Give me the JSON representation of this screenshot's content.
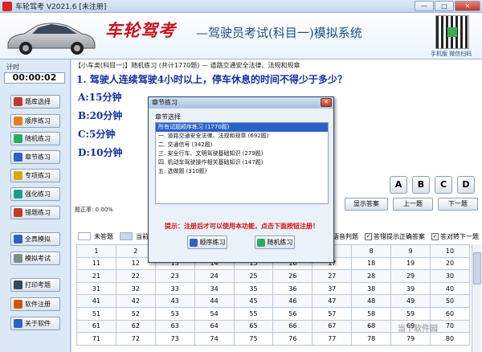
{
  "window": {
    "title": "车轮驾考 V2021.6 [未注册]",
    "minimize": "—",
    "maximize": "□",
    "close": "✕"
  },
  "banner": {
    "logo": "车轮驾考",
    "subtitle": "—驾驶员考试(科目一)模拟系统",
    "qr_label": "手机版  微信扫码"
  },
  "left": {
    "timer_label": "计时",
    "timer": "00:00:02",
    "buttons": [
      {
        "label": "题库选择",
        "color": "#c0392b"
      },
      {
        "label": "顺序练习",
        "color": "#e67e22"
      },
      {
        "label": "随机练习",
        "color": "#27ae60"
      },
      {
        "label": "章节练习",
        "color": "#2a62c8"
      },
      {
        "label": "专项练习",
        "color": "#d4ac0d"
      },
      {
        "label": "强化练习",
        "color": "#16a085"
      },
      {
        "label": "错题练习",
        "color": "#c0392b"
      },
      {
        "label": "全真模拟",
        "color": "#2a62c8"
      },
      {
        "label": "模拟考试",
        "color": "#7f8c8d"
      },
      {
        "label": "打印考题",
        "color": "#34495e"
      },
      {
        "label": "软件注册",
        "color": "#d35400"
      },
      {
        "label": "关于软件",
        "color": "#2a62c8"
      }
    ]
  },
  "main": {
    "breadcrumb": "【小车类(科目一)】随机练习 (共计1770题) — 道路交通安全法律、法规和规章",
    "question": "1. 驾驶人连续驾驶4小时以上，停车休息的时间不得少于多少？",
    "options": [
      "A:15分钟",
      "B:20分钟",
      "C:5分钟",
      "D:10分钟"
    ],
    "answer_buttons": [
      "A",
      "B",
      "C",
      "D"
    ],
    "correct_rate": "题正率: 0.00%",
    "nav": {
      "show_answer": "显示答案",
      "prev": "上一题",
      "next": "下一题"
    },
    "legend": {
      "undone": "未答题",
      "current": "当前",
      "voice": "语音判题",
      "show_correct": "答错提示正确答案",
      "auto_next": "答对转下一题"
    },
    "grid": [
      [
        "1",
        "2",
        "3",
        "4",
        "5",
        "6",
        "7",
        "8",
        "9",
        "10"
      ],
      [
        "11",
        "12",
        "13",
        "14",
        "15",
        "16",
        "17",
        "18",
        "19",
        "20"
      ],
      [
        "21",
        "22",
        "23",
        "24",
        "25",
        "26",
        "27",
        "28",
        "29",
        "30"
      ],
      [
        "31",
        "32",
        "33",
        "34",
        "35",
        "36",
        "37",
        "38",
        "39",
        "40"
      ],
      [
        "41",
        "42",
        "43",
        "44",
        "45",
        "46",
        "47",
        "48",
        "49",
        "50"
      ],
      [
        "51",
        "52",
        "53",
        "54",
        "55",
        "56",
        "57",
        "58",
        "59",
        "60"
      ],
      [
        "61",
        "62",
        "63",
        "64",
        "65",
        "66",
        "67",
        "68",
        "69",
        "70"
      ],
      [
        "71",
        "72",
        "73",
        "74",
        "75",
        "76",
        "77",
        "78",
        "79",
        "80"
      ]
    ]
  },
  "dialog": {
    "title": "章节练习",
    "group_label": "章节选择",
    "chapters": [
      "所有试题顺序练习 (1770题)",
      "一. 道路交通安全法律、法规和规章 (692题)",
      "二. 交通信号 (342题)",
      "三. 安全行车、文明驾驶基础知识 (279题)",
      "四. 机动车驾驶操作相关基础知识 (147题)",
      "五. 选做题 (310题)"
    ],
    "hint": "提示：注册后才可以使用本功能，点击下面按钮注册！",
    "btn_order": "顺序练习",
    "btn_random": "随机练习"
  },
  "watermark": "当下软件园"
}
